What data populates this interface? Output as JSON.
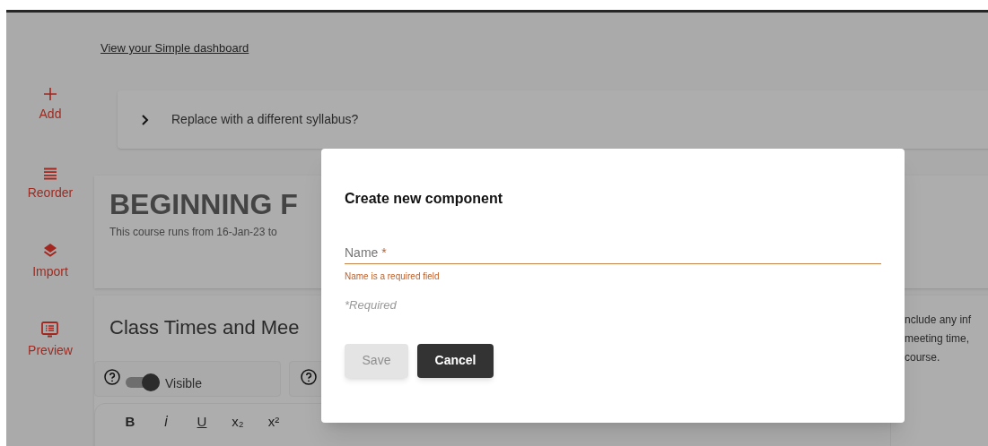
{
  "link": {
    "text": "View your Simple dashboard"
  },
  "sidebar": {
    "items": [
      {
        "kind": "add",
        "label": "Add"
      },
      {
        "kind": "reorder",
        "label": "Reorder"
      },
      {
        "kind": "import",
        "label": "Import"
      },
      {
        "kind": "preview",
        "label": "Preview"
      }
    ]
  },
  "accordion": {
    "label": "Replace with a different syllabus?",
    "expanded": false
  },
  "course_card": {
    "title": "BEGINNING F",
    "dates": "This course runs from 16-Jan-23 to"
  },
  "section": {
    "title": "Class Times and Mee",
    "visibility": {
      "label": "Visible",
      "on": true
    },
    "description_lines": [
      "nclude any inf",
      "meeting time,",
      "course."
    ],
    "toolbar": [
      {
        "kind": "bold",
        "label": "B"
      },
      {
        "kind": "italic",
        "label": "i"
      },
      {
        "kind": "underline",
        "label": "U"
      },
      {
        "kind": "subscript",
        "label": "x₂"
      },
      {
        "kind": "superscript",
        "label": "x²"
      }
    ]
  },
  "dialog": {
    "title": "Create new component",
    "field": {
      "label": "Name",
      "required_mark": "*",
      "error": "Name is a required field"
    },
    "note": "*Required",
    "buttons": [
      {
        "kind": "primary",
        "label": "Save",
        "disabled": true
      },
      {
        "kind": "secondary",
        "label": "Cancel",
        "disabled": false
      }
    ]
  }
}
